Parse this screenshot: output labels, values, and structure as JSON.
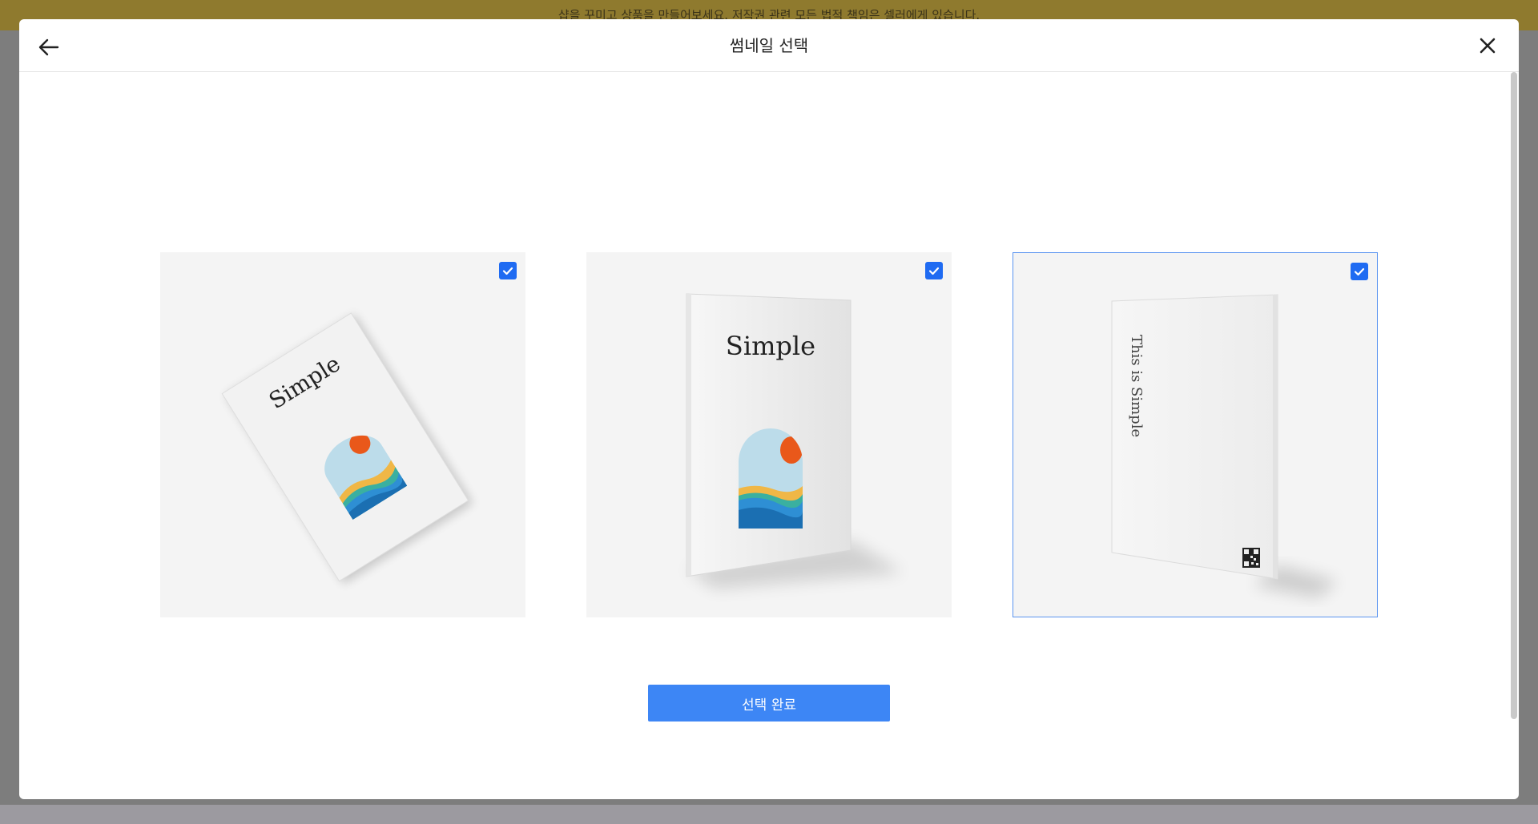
{
  "banner": {
    "text": "샵을 꾸미고 상품을 만들어보세요. 저작권 관련 모든 법적 책임은 셀러에게 있습니다."
  },
  "modal": {
    "title": "썸네일 선택",
    "back_icon": "arrow-left-icon",
    "close_icon": "close-icon"
  },
  "thumbnails": [
    {
      "cover_text": "Simple",
      "selected": true,
      "highlighted": false
    },
    {
      "cover_text": "Simple",
      "selected": true,
      "highlighted": false
    },
    {
      "cover_text": "This is Simple",
      "selected": true,
      "highlighted": true
    }
  ],
  "footer": {
    "done_label": "선택 완료"
  },
  "colors": {
    "accent": "#3d86f5",
    "checkbox": "#1f6bf2",
    "banner": "#8f7a2e"
  }
}
